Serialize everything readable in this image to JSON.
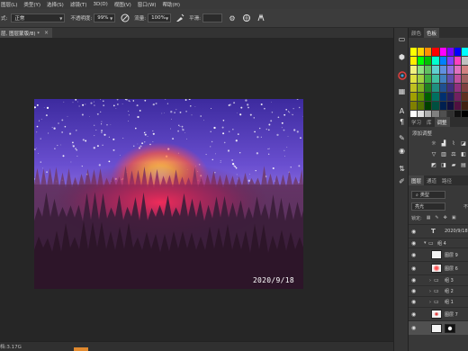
{
  "menubar": {
    "items": [
      "图层(L)",
      "类型(Y)",
      "选择(S)",
      "滤镜(T)",
      "3D(D)",
      "视图(V)",
      "窗口(W)",
      "帮助(H)"
    ]
  },
  "options": {
    "mode_label": "式:",
    "mode_value": "正常",
    "opacity_label": "不透明度:",
    "opacity_value": "99%",
    "flow_label": "流量:",
    "flow_value": "100%",
    "smooth_label": "平滑:"
  },
  "document": {
    "tab_title": "层, 图层蒙版/8) *",
    "close": "×",
    "date_text": "2020/9/18"
  },
  "status": {
    "doc_size": "档:3.17G"
  },
  "panels": {
    "top_tabs": [
      "颜色",
      "色板"
    ],
    "mid_tabs": [
      "学习",
      "库",
      "调整"
    ],
    "adjust_title": "添加调整",
    "layer_tabs": [
      "图层",
      "通道",
      "路径"
    ],
    "filter_label": "类型",
    "blend_mode": "亮光",
    "opacity_prefix": "不",
    "lock_label": "锁定:"
  },
  "layers": [
    {
      "name": "2020/9/18",
      "kind": "text"
    },
    {
      "name": "组 4",
      "kind": "group"
    },
    {
      "name": "图层 9",
      "kind": "layer"
    },
    {
      "name": "图层 6",
      "kind": "layer"
    },
    {
      "name": "组 3",
      "kind": "group"
    },
    {
      "name": "组 2",
      "kind": "group"
    },
    {
      "name": "组 1",
      "kind": "group"
    },
    {
      "name": "图层 7",
      "kind": "layer"
    },
    {
      "name": "",
      "kind": "layer"
    }
  ],
  "colors": {
    "accent_orange": "#e0892e",
    "ui_dark": "#262626",
    "panel_bg": "#3a3a3a"
  }
}
